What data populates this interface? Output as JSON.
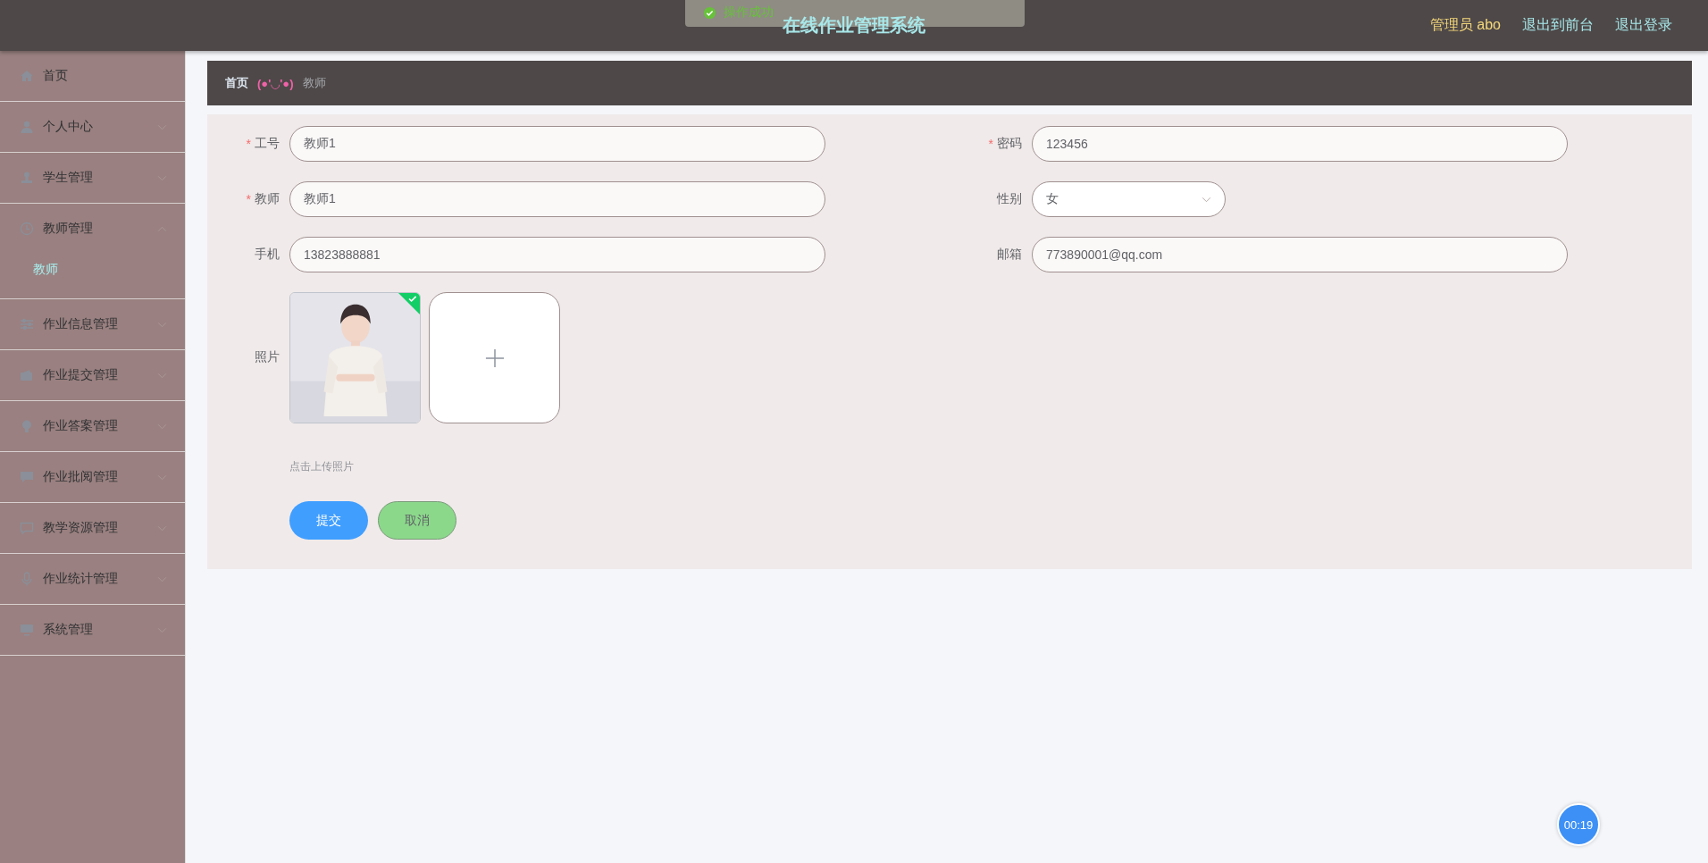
{
  "header": {
    "title": "在线作业管理系统",
    "toast": "操作成功",
    "links": [
      {
        "label": "管理员 abo",
        "kind": "user"
      },
      {
        "label": "退出到前台",
        "kind": "link"
      },
      {
        "label": "退出登录",
        "kind": "link"
      }
    ]
  },
  "sidebar": {
    "items": [
      {
        "label": "首页"
      },
      {
        "label": "个人中心",
        "expanded": false
      },
      {
        "label": "学生管理",
        "expanded": false
      },
      {
        "label": "教师管理",
        "expanded": true,
        "children": [
          {
            "label": "教师",
            "selected": true
          }
        ]
      },
      {
        "label": "作业信息管理",
        "expanded": false
      },
      {
        "label": "作业提交管理",
        "expanded": false
      },
      {
        "label": "作业答案管理",
        "expanded": false
      },
      {
        "label": "作业批阅管理",
        "expanded": false
      },
      {
        "label": "教学资源管理",
        "expanded": false
      },
      {
        "label": "作业统计管理",
        "expanded": false
      },
      {
        "label": "系统管理",
        "expanded": false
      }
    ]
  },
  "breadcrumb": {
    "home": "首页",
    "separator": "(●'◡'●)",
    "current": "教师"
  },
  "form": {
    "fields": [
      {
        "label": "工号",
        "kind": "text",
        "required_mark": "*",
        "value": "教师1"
      },
      {
        "label": "密码",
        "kind": "text",
        "required_mark": "*",
        "value": "123456"
      },
      {
        "label": "教师",
        "kind": "text",
        "required_mark": "*",
        "value": "教师1"
      },
      {
        "label": "性别",
        "kind": "select",
        "value": "女"
      },
      {
        "label": "手机",
        "kind": "text",
        "value": "13823888881"
      },
      {
        "label": "邮箱",
        "kind": "text",
        "value": "773890001@qq.com"
      },
      {
        "label": "照片",
        "kind": "upload",
        "uploaded": true,
        "hint": "点击上传照片"
      }
    ],
    "buttons": [
      {
        "label": "提交",
        "kind": "primary"
      },
      {
        "label": "取消",
        "kind": "cancel"
      }
    ]
  },
  "timer": "00:19"
}
